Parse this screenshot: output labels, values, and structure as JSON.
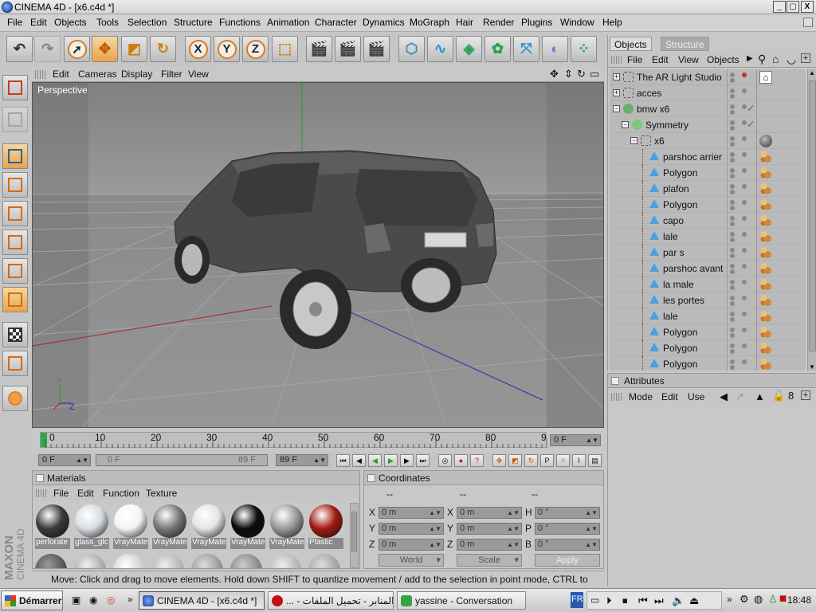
{
  "window": {
    "title": "CINEMA 4D - [x6.c4d *]",
    "min": "_",
    "max": "▢",
    "close": "X"
  },
  "menubar": [
    "File",
    "Edit",
    "Objects",
    "Tools",
    "Selection",
    "Structure",
    "Functions",
    "Animation",
    "Character",
    "Dynamics",
    "MoGraph",
    "Hair",
    "Render",
    "Plugins",
    "Window",
    "Help"
  ],
  "toolbar": {
    "x": "X",
    "y": "Y",
    "z": "Z"
  },
  "viewport": {
    "menu": [
      "Edit",
      "Cameras",
      "Display",
      "Filter",
      "View"
    ],
    "label": "Perspective",
    "axis_y": "Y",
    "axis_z": "Z"
  },
  "timeline": {
    "ticks": [
      "0",
      "10",
      "20",
      "30",
      "40",
      "50",
      "60",
      "70",
      "80",
      "9"
    ],
    "current_frame": "0 F",
    "start_field": "0 F",
    "range_start": "0 F",
    "range_end": "89 F",
    "end_field": "89 F"
  },
  "materials": {
    "title": "Materials",
    "menu": [
      "File",
      "Edit",
      "Function",
      "Texture"
    ],
    "items": [
      {
        "name": "perforate",
        "color": "#3a3a3a"
      },
      {
        "name": "glass_glc",
        "color": "#d8dde2"
      },
      {
        "name": "VrayMate",
        "color": "#f4f4f4"
      },
      {
        "name": "VrayMate",
        "color": "#777777"
      },
      {
        "name": "VrayMate",
        "color": "#e4e4e4"
      },
      {
        "name": "VrayMate",
        "color": "#0b0b0b"
      },
      {
        "name": "VrayMate",
        "color": "#9a9a9a"
      },
      {
        "name": "Plastic",
        "color": "#a01a10"
      }
    ]
  },
  "coordinates": {
    "title": "Coordinates",
    "headers": [
      "--",
      "--",
      "--"
    ],
    "pos": {
      "x": "0 m",
      "y": "0 m",
      "z": "0 m"
    },
    "size": {
      "x": "0 m",
      "y": "0 m",
      "z": "0 m"
    },
    "rot": {
      "h": "0 °",
      "p": "0 °",
      "b": "0 °"
    },
    "labels": {
      "x": "X",
      "y": "Y",
      "z": "Z",
      "h": "H",
      "p": "P",
      "b": "B"
    },
    "mode": "World",
    "type": "Scale",
    "apply": "Apply"
  },
  "status": "Move: Click and drag to move elements. Hold down SHIFT to quantize movement / add to the selection in point mode, CTRL to remove.",
  "objects": {
    "tabs": [
      "Objects",
      "Structure"
    ],
    "menu": [
      "File",
      "Edit",
      "View",
      "Objects"
    ],
    "rows": [
      {
        "name": "The AR Light Studio",
        "depth": 0,
        "type": "null",
        "exp": "+"
      },
      {
        "name": "acces",
        "depth": 0,
        "type": "null",
        "exp": "+"
      },
      {
        "name": "bmw x6",
        "depth": 0,
        "type": "hypern",
        "exp": "-"
      },
      {
        "name": "Symmetry",
        "depth": 1,
        "type": "sym",
        "exp": "-"
      },
      {
        "name": "x6",
        "depth": 2,
        "type": "null",
        "exp": "-"
      },
      {
        "name": "parshoc arrier",
        "depth": 3,
        "type": "poly"
      },
      {
        "name": "Polygon",
        "depth": 3,
        "type": "poly"
      },
      {
        "name": "plafon",
        "depth": 3,
        "type": "poly"
      },
      {
        "name": "Polygon",
        "depth": 3,
        "type": "poly"
      },
      {
        "name": "capo",
        "depth": 3,
        "type": "poly"
      },
      {
        "name": "lale",
        "depth": 3,
        "type": "poly"
      },
      {
        "name": "par s",
        "depth": 3,
        "type": "poly"
      },
      {
        "name": "parshoc avant",
        "depth": 3,
        "type": "poly"
      },
      {
        "name": "la male",
        "depth": 3,
        "type": "poly"
      },
      {
        "name": "les portes",
        "depth": 3,
        "type": "poly"
      },
      {
        "name": "lale",
        "depth": 3,
        "type": "poly"
      },
      {
        "name": "Polygon",
        "depth": 3,
        "type": "poly"
      },
      {
        "name": "Polygon",
        "depth": 3,
        "type": "poly"
      },
      {
        "name": "Polygon",
        "depth": 3,
        "type": "poly"
      }
    ]
  },
  "attributes": {
    "title": "Attributes",
    "menu": [
      "Mode",
      "Edit",
      "User"
    ]
  },
  "taskbar": {
    "start": "Démarrer",
    "tasks": [
      "CINEMA 4D - [x6.c4d *]",
      "المنابر - تحميل الملفات - ...",
      "yassine - Conversation"
    ],
    "lang": "FR",
    "clock": "18:48",
    "more": "»"
  },
  "brand": {
    "line1": "MAXON",
    "line2": "CINEMA 4D"
  }
}
